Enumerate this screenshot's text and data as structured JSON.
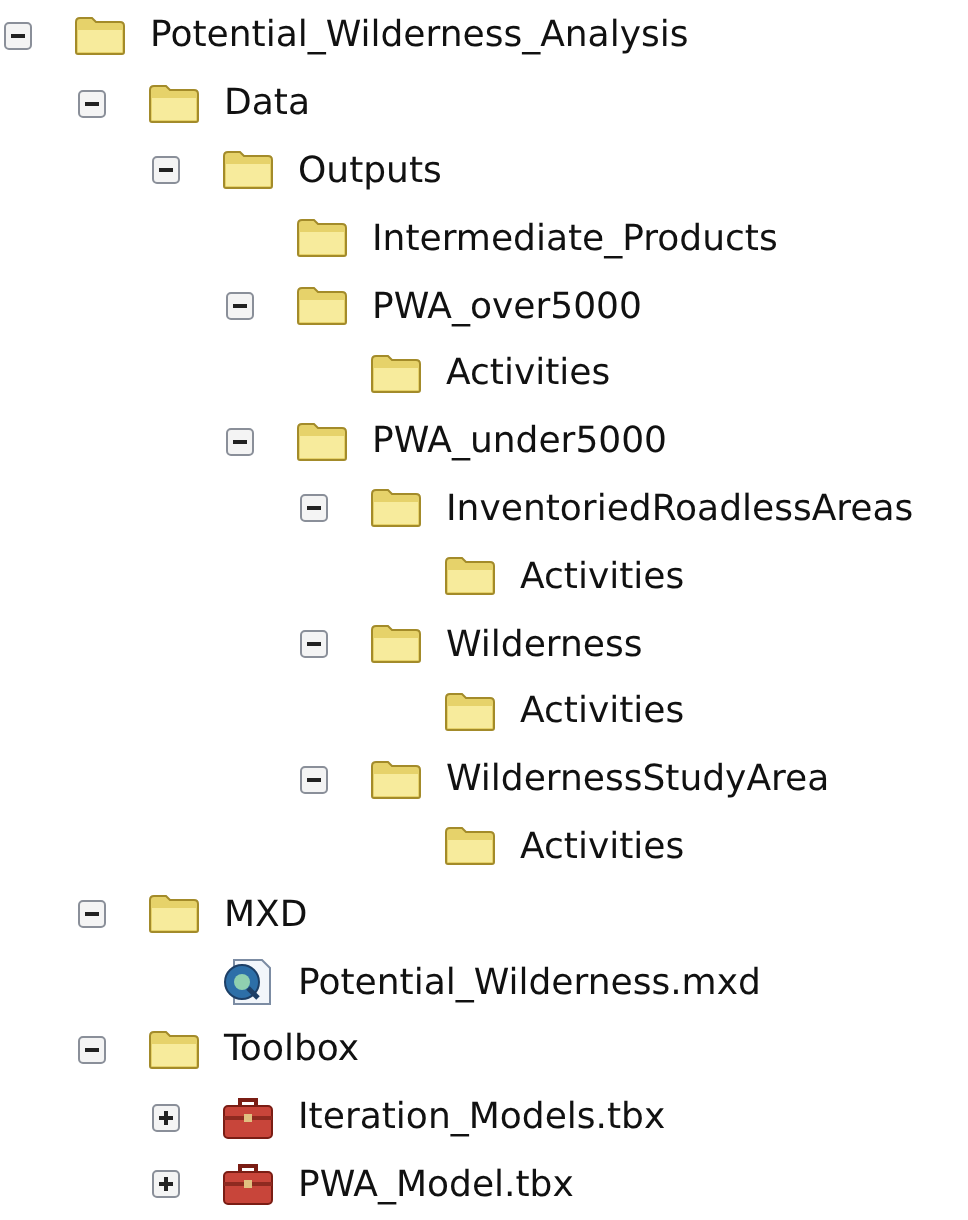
{
  "tree": [
    {
      "label": "Potential_Wilderness_Analysis",
      "kind": "folder",
      "expanded": true,
      "children": [
        {
          "label": "Data",
          "kind": "folder",
          "expanded": true,
          "children": [
            {
              "label": "Outputs",
              "kind": "folder",
              "expanded": true,
              "children": [
                {
                  "label": "Intermediate_Products",
                  "kind": "folder"
                },
                {
                  "label": "PWA_over5000",
                  "kind": "folder",
                  "expanded": true,
                  "children": [
                    {
                      "label": "Activities",
                      "kind": "folder"
                    }
                  ]
                },
                {
                  "label": "PWA_under5000",
                  "kind": "folder",
                  "expanded": true,
                  "children": [
                    {
                      "label": "InventoriedRoadlessAreas",
                      "kind": "folder",
                      "expanded": true,
                      "children": [
                        {
                          "label": "Activities",
                          "kind": "folder"
                        }
                      ]
                    },
                    {
                      "label": "Wilderness",
                      "kind": "folder",
                      "expanded": true,
                      "children": [
                        {
                          "label": "Activities",
                          "kind": "folder"
                        }
                      ]
                    },
                    {
                      "label": "WildernessStudyArea",
                      "kind": "folder",
                      "expanded": true,
                      "children": [
                        {
                          "label": "Activities",
                          "kind": "folder"
                        }
                      ]
                    }
                  ]
                }
              ]
            }
          ]
        },
        {
          "label": "MXD",
          "kind": "folder",
          "expanded": true,
          "children": [
            {
              "label": "Potential_Wilderness.mxd",
              "kind": "map"
            }
          ]
        },
        {
          "label": "Toolbox",
          "kind": "folder",
          "expanded": true,
          "children": [
            {
              "label": "Iteration_Models.tbx",
              "kind": "toolbox",
              "expanded": false
            },
            {
              "label": "PWA_Model.tbx",
              "kind": "toolbox",
              "expanded": false
            }
          ]
        }
      ]
    }
  ]
}
